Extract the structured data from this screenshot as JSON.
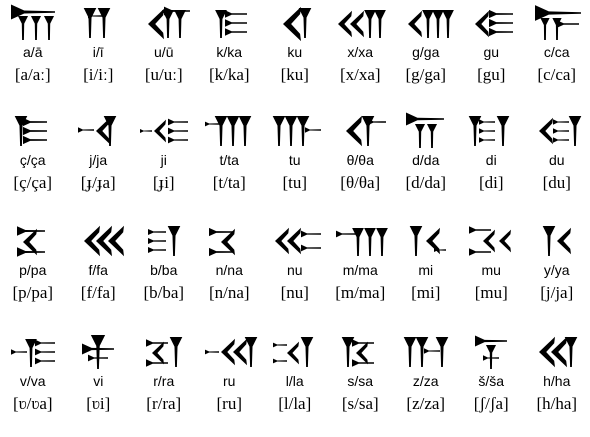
{
  "signs": [
    {
      "translit": "a/ā",
      "ipa": "[a/aː]",
      "icon": "cuneiform-a"
    },
    {
      "translit": "i/ī",
      "ipa": "[i/iː]",
      "icon": "cuneiform-i"
    },
    {
      "translit": "u/ū",
      "ipa": "[u/uː]",
      "icon": "cuneiform-u"
    },
    {
      "translit": "k/ka",
      "ipa": "[k/ka]",
      "icon": "cuneiform-ka"
    },
    {
      "translit": "ku",
      "ipa": "[ku]",
      "icon": "cuneiform-ku"
    },
    {
      "translit": "x/xa",
      "ipa": "[x/xa]",
      "icon": "cuneiform-xa"
    },
    {
      "translit": "g/ga",
      "ipa": "[g/ga]",
      "icon": "cuneiform-ga"
    },
    {
      "translit": "gu",
      "ipa": "[gu]",
      "icon": "cuneiform-gu"
    },
    {
      "translit": "c/ca",
      "ipa": "[c/ca]",
      "icon": "cuneiform-ca"
    },
    {
      "translit": "ç/ça",
      "ipa": "[ç/ça]",
      "icon": "cuneiform-ca-cedilla"
    },
    {
      "translit": "j/ja",
      "ipa": "[ɟ/ɟa]",
      "icon": "cuneiform-ja"
    },
    {
      "translit": "ji",
      "ipa": "[ɟi]",
      "icon": "cuneiform-ji"
    },
    {
      "translit": "t/ta",
      "ipa": "[t/ta]",
      "icon": "cuneiform-ta"
    },
    {
      "translit": "tu",
      "ipa": "[tu]",
      "icon": "cuneiform-tu"
    },
    {
      "translit": "θ/θa",
      "ipa": "[θ/θa]",
      "icon": "cuneiform-tha"
    },
    {
      "translit": "d/da",
      "ipa": "[d/da]",
      "icon": "cuneiform-da"
    },
    {
      "translit": "di",
      "ipa": "[di]",
      "icon": "cuneiform-di"
    },
    {
      "translit": "du",
      "ipa": "[du]",
      "icon": "cuneiform-du"
    },
    {
      "translit": "p/pa",
      "ipa": "[p/pa]",
      "icon": "cuneiform-pa"
    },
    {
      "translit": "f/fa",
      "ipa": "[f/fa]",
      "icon": "cuneiform-fa"
    },
    {
      "translit": "b/ba",
      "ipa": "[b/ba]",
      "icon": "cuneiform-ba"
    },
    {
      "translit": "n/na",
      "ipa": "[n/na]",
      "icon": "cuneiform-na"
    },
    {
      "translit": "nu",
      "ipa": "[nu]",
      "icon": "cuneiform-nu"
    },
    {
      "translit": "m/ma",
      "ipa": "[m/ma]",
      "icon": "cuneiform-ma"
    },
    {
      "translit": "mi",
      "ipa": "[mi]",
      "icon": "cuneiform-mi"
    },
    {
      "translit": "mu",
      "ipa": "[mu]",
      "icon": "cuneiform-mu"
    },
    {
      "translit": "y/ya",
      "ipa": "[j/ja]",
      "icon": "cuneiform-ya"
    },
    {
      "translit": "v/va",
      "ipa": "[ʋ/ʋa]",
      "icon": "cuneiform-va"
    },
    {
      "translit": "vi",
      "ipa": "[ʋi]",
      "icon": "cuneiform-vi"
    },
    {
      "translit": "r/ra",
      "ipa": "[r/ra]",
      "icon": "cuneiform-ra"
    },
    {
      "translit": "ru",
      "ipa": "[ru]",
      "icon": "cuneiform-ru"
    },
    {
      "translit": "l/la",
      "ipa": "[l/la]",
      "icon": "cuneiform-la"
    },
    {
      "translit": "s/sa",
      "ipa": "[s/sa]",
      "icon": "cuneiform-sa"
    },
    {
      "translit": "z/za",
      "ipa": "[z/za]",
      "icon": "cuneiform-za"
    },
    {
      "translit": "š/ša",
      "ipa": "[ʃ/ʃa]",
      "icon": "cuneiform-sha"
    },
    {
      "translit": "h/ha",
      "ipa": "[h/ha]",
      "icon": "cuneiform-ha"
    }
  ]
}
